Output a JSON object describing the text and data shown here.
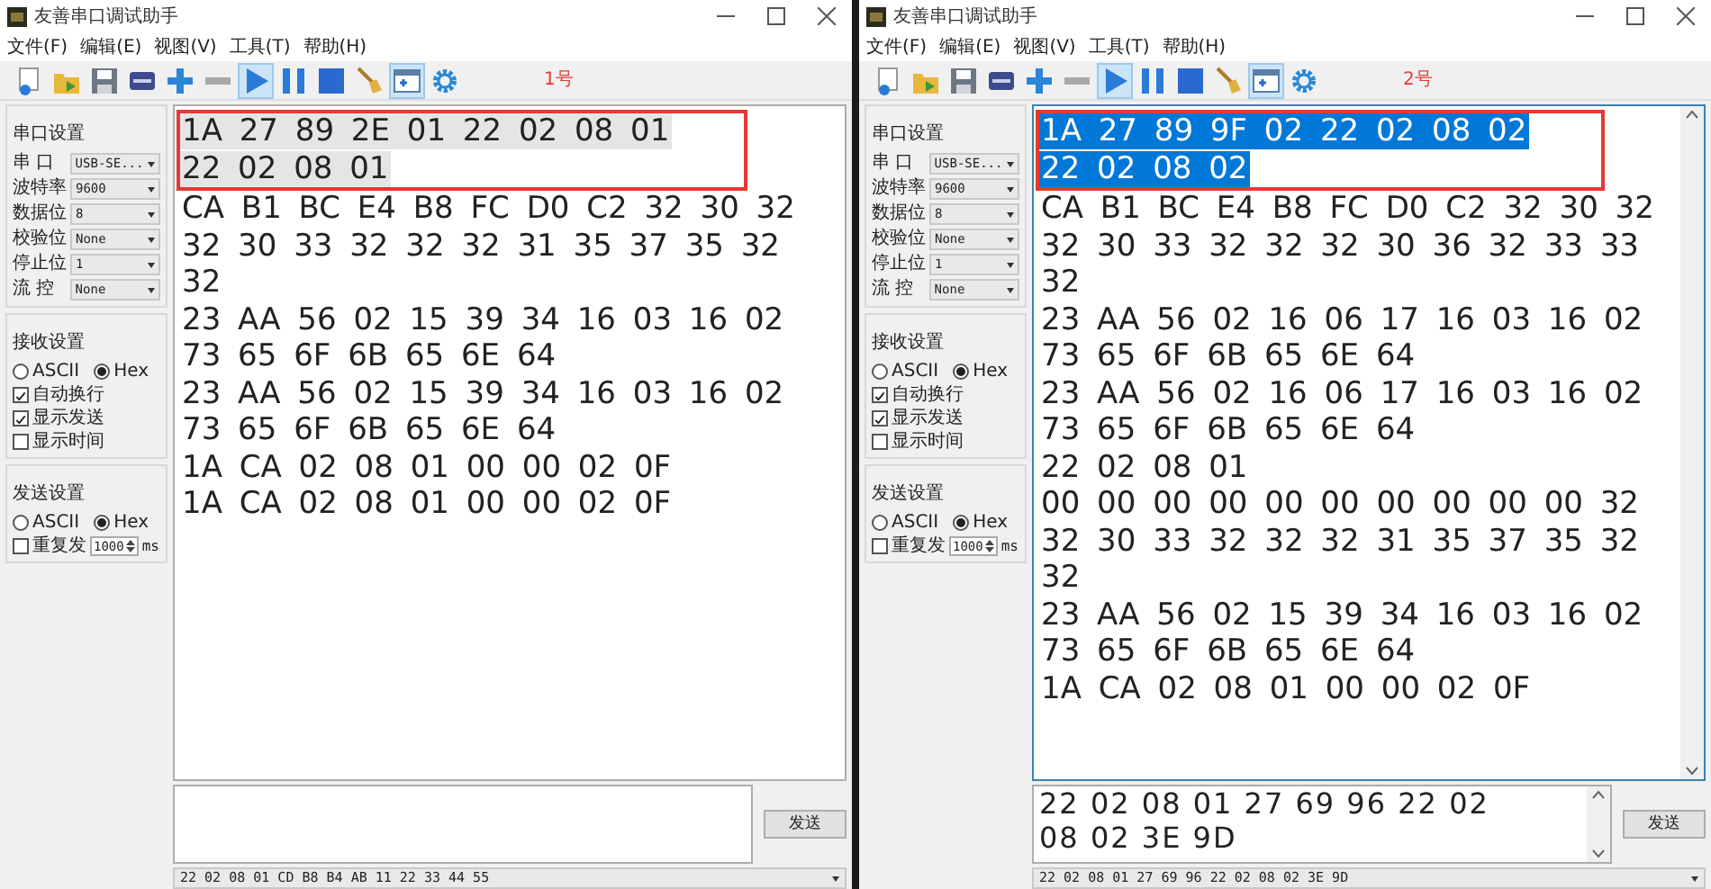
{
  "windows": [
    {
      "title": "友善串口调试助手",
      "focused": false,
      "menu": [
        "文件(F)",
        "编辑(E)",
        "视图(V)",
        "工具(T)",
        "帮助(H)"
      ],
      "toolbar": [
        {
          "kind": "new",
          "on": false
        },
        {
          "kind": "folder",
          "on": false
        },
        {
          "kind": "save",
          "on": false
        },
        {
          "kind": "log",
          "on": false
        },
        {
          "kind": "add",
          "on": false
        },
        {
          "kind": "remove",
          "on": false
        },
        {
          "kind": "play",
          "on": true
        },
        {
          "kind": "pause",
          "on": false
        },
        {
          "kind": "stop",
          "on": false
        },
        {
          "kind": "broom",
          "on": false
        },
        {
          "kind": "window",
          "on": true
        },
        {
          "kind": "gear",
          "on": false
        }
      ],
      "toolbar_label": "1号",
      "port_settings": {
        "title": "串口设置",
        "fields": [
          {
            "label": "串 口",
            "value": "USB-SE..."
          },
          {
            "label": "波特率",
            "value": "9600"
          },
          {
            "label": "数据位",
            "value": "8"
          },
          {
            "label": "校验位",
            "value": "None"
          },
          {
            "label": "停止位",
            "value": "1"
          },
          {
            "label": "流 控",
            "value": "None"
          }
        ]
      },
      "receive_settings": {
        "title": "接收设置",
        "modes": [
          {
            "label": "ASCII",
            "selected": false
          },
          {
            "label": "Hex",
            "selected": true
          }
        ],
        "options": [
          {
            "label": "自动换行",
            "checked": true
          },
          {
            "label": "显示发送",
            "checked": true
          },
          {
            "label": "显示时间",
            "checked": false
          }
        ]
      },
      "send_settings": {
        "title": "发送设置",
        "modes": [
          {
            "label": "ASCII",
            "selected": false
          },
          {
            "label": "Hex",
            "selected": true
          }
        ],
        "repeat": {
          "label": "重复发",
          "checked": false
        },
        "interval": "1000",
        "unit": "ms"
      },
      "receive": {
        "scrollbar": false,
        "blocks": [
          {
            "kind": "boxed",
            "lines": [
              {
                "text": "1A 27 89 2E 01 22 02 08 01",
                "selected": true
              },
              {
                "text": "22 02 08 01",
                "selected": true
              }
            ]
          },
          {
            "kind": "plain",
            "lines": [
              {
                "text": "CA B1 BC E4 B8 FC D0 C2 32 30 32",
                "selected": false
              },
              {
                "text": "32 30 33 32 32 32 31 35 37 35 32",
                "selected": false
              },
              {
                "text": "32",
                "selected": false
              },
              {
                "text": "23 AA 56 02 15 39 34 16 03 16 02",
                "selected": false
              },
              {
                "text": "73 65 6F 6B 65 6E 64",
                "selected": false
              },
              {
                "text": "23 AA 56 02 15 39 34 16 03 16 02",
                "selected": false
              },
              {
                "text": "73 65 6F 6B 65 6E 64",
                "selected": false
              },
              {
                "text": "1A CA 02 08 01 00 00 02 0F",
                "selected": false
              },
              {
                "text": "1A CA 02 08 01 00 00 02 0F",
                "selected": false
              }
            ]
          }
        ]
      },
      "send": {
        "scrollbar": false
      },
      "send_button": "发送",
      "history": "22 02 08 01 CD B8 B4 AB 11 22 33 44 55"
    },
    {
      "title": "友善串口调试助手",
      "focused": true,
      "menu": [
        "文件(F)",
        "编辑(E)",
        "视图(V)",
        "工具(T)",
        "帮助(H)"
      ],
      "toolbar": [
        {
          "kind": "new",
          "on": false
        },
        {
          "kind": "folder",
          "on": false
        },
        {
          "kind": "save",
          "on": false
        },
        {
          "kind": "log",
          "on": false
        },
        {
          "kind": "add",
          "on": false
        },
        {
          "kind": "remove",
          "on": false
        },
        {
          "kind": "play",
          "on": true
        },
        {
          "kind": "pause",
          "on": false
        },
        {
          "kind": "stop",
          "on": false
        },
        {
          "kind": "broom",
          "on": false
        },
        {
          "kind": "window",
          "on": true
        },
        {
          "kind": "gear",
          "on": false
        }
      ],
      "toolbar_label": "2号",
      "port_settings": {
        "title": "串口设置",
        "fields": [
          {
            "label": "串 口",
            "value": "USB-SE..."
          },
          {
            "label": "波特率",
            "value": "9600"
          },
          {
            "label": "数据位",
            "value": "8"
          },
          {
            "label": "校验位",
            "value": "None"
          },
          {
            "label": "停止位",
            "value": "1"
          },
          {
            "label": "流 控",
            "value": "None"
          }
        ]
      },
      "receive_settings": {
        "title": "接收设置",
        "modes": [
          {
            "label": "ASCII",
            "selected": false
          },
          {
            "label": "Hex",
            "selected": true
          }
        ],
        "options": [
          {
            "label": "自动换行",
            "checked": true
          },
          {
            "label": "显示发送",
            "checked": true
          },
          {
            "label": "显示时间",
            "checked": false
          }
        ]
      },
      "send_settings": {
        "title": "发送设置",
        "modes": [
          {
            "label": "ASCII",
            "selected": false
          },
          {
            "label": "Hex",
            "selected": true
          }
        ],
        "repeat": {
          "label": "重复发",
          "checked": false
        },
        "interval": "1000",
        "unit": "ms"
      },
      "receive": {
        "scrollbar": true,
        "blocks": [
          {
            "kind": "boxed",
            "lines": [
              {
                "text": "1A 27 89 9F 02 22 02 08 02",
                "selected": true
              },
              {
                "text": "22 02 08 02",
                "selected": true
              }
            ]
          },
          {
            "kind": "plain",
            "lines": [
              {
                "text": "CA B1 BC E4 B8 FC D0 C2 32 30 32",
                "selected": false
              },
              {
                "text": "32 30 33 32 32 32 30 36 32 33 33",
                "selected": false
              },
              {
                "text": "32",
                "selected": false
              },
              {
                "text": "23 AA 56 02 16 06 17 16 03 16 02",
                "selected": false
              },
              {
                "text": "73 65 6F 6B 65 6E 64",
                "selected": false
              },
              {
                "text": "23 AA 56 02 16 06 17 16 03 16 02",
                "selected": false
              },
              {
                "text": "73 65 6F 6B 65 6E 64",
                "selected": false
              },
              {
                "text": "22 02 08 01",
                "selected": false
              },
              {
                "text": "00 00 00 00 00 00 00 00 00 00 32",
                "selected": false
              },
              {
                "text": "32 30 33 32 32 32 31 35 37 35 32",
                "selected": false
              },
              {
                "text": "32",
                "selected": false
              },
              {
                "text": "23 AA 56 02 15 39 34 16 03 16 02",
                "selected": false
              },
              {
                "text": "73 65 6F 6B 65 6E 64",
                "selected": false
              },
              {
                "text": "1A CA 02 08 01 00 00 02 0F",
                "selected": false
              }
            ]
          }
        ]
      },
      "send": {
        "scrollbar": true,
        "lines": [
          "22 02 08 01 27 69 96 22 02",
          "08 02 3E 9D"
        ]
      },
      "send_button": "发送",
      "history": "22 02 08 01 27 69 96 22 02 08 02 3E 9D"
    }
  ]
}
